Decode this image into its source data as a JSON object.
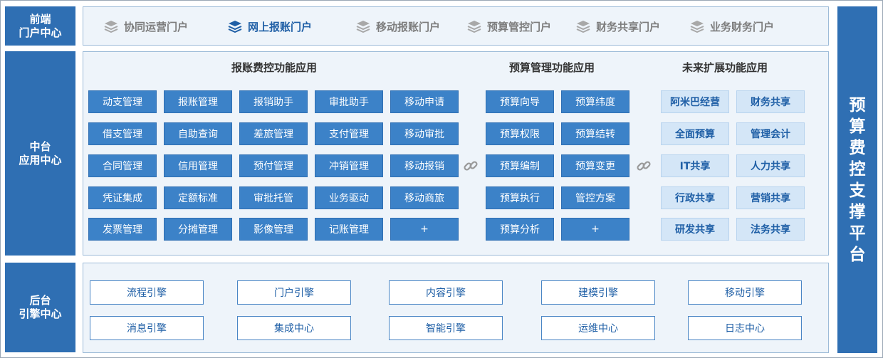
{
  "front": {
    "label_line1": "前端",
    "label_line2": "门户中心",
    "portals": [
      {
        "label": "协同运营门户",
        "active": false
      },
      {
        "label": "网上报账门户",
        "active": true
      },
      {
        "label": "移动报账门户",
        "active": false
      },
      {
        "label": "预算管控门户",
        "active": false
      },
      {
        "label": "财务共享门户",
        "active": false
      },
      {
        "label": "业务财务门户",
        "active": false
      }
    ]
  },
  "middle": {
    "label_line1": "中台",
    "label_line2": "应用中心",
    "groups": [
      {
        "title": "报账费控功能应用",
        "rows": [
          [
            "动支管理",
            "报账管理",
            "报销助手",
            "审批助手",
            "移动申请"
          ],
          [
            "借支管理",
            "自助查询",
            "差旅管理",
            "支付管理",
            "移动审批"
          ],
          [
            "合同管理",
            "信用管理",
            "预付管理",
            "冲销管理",
            "移动报销"
          ],
          [
            "凭证集成",
            "定额标准",
            "审批托管",
            "业务驱动",
            "移动商旅"
          ],
          [
            "发票管理",
            "分摊管理",
            "影像管理",
            "记账管理",
            "+"
          ]
        ]
      },
      {
        "title": "预算管理功能应用",
        "rows": [
          [
            "预算向导",
            "预算纬度"
          ],
          [
            "预算权限",
            "预算结转"
          ],
          [
            "预算编制",
            "预算变更"
          ],
          [
            "预算执行",
            "管控方案"
          ],
          [
            "预算分析",
            "+"
          ]
        ]
      },
      {
        "title": "未来扩展功能应用",
        "rows": [
          [
            "阿米巴经营",
            "财务共享"
          ],
          [
            "全面预算",
            "管理会计"
          ],
          [
            "IT共享",
            "人力共享"
          ],
          [
            "行政共享",
            "营销共享"
          ],
          [
            "研发共享",
            "法务共享"
          ]
        ]
      }
    ]
  },
  "back": {
    "label_line1": "后台",
    "label_line2": "引擎中心",
    "engines": [
      [
        "流程引擎",
        "门户引擎",
        "内容引擎",
        "建模引擎",
        "移动引擎"
      ],
      [
        "消息引擎",
        "集成中心",
        "智能引擎",
        "运维中心",
        "日志中心"
      ]
    ]
  },
  "platform": {
    "chars": [
      "预",
      "算",
      "费",
      "控",
      "支",
      "撑",
      "平",
      "台"
    ]
  },
  "colors": {
    "primary": "#2f6fb3",
    "button": "#3c82c8",
    "light_button": "#d4e6f7",
    "panel_bg": "#eef4fa",
    "text_blue": "#1f5fa6"
  },
  "icons": {
    "portal": "layers-icon",
    "connector": "chain-link-icon"
  }
}
